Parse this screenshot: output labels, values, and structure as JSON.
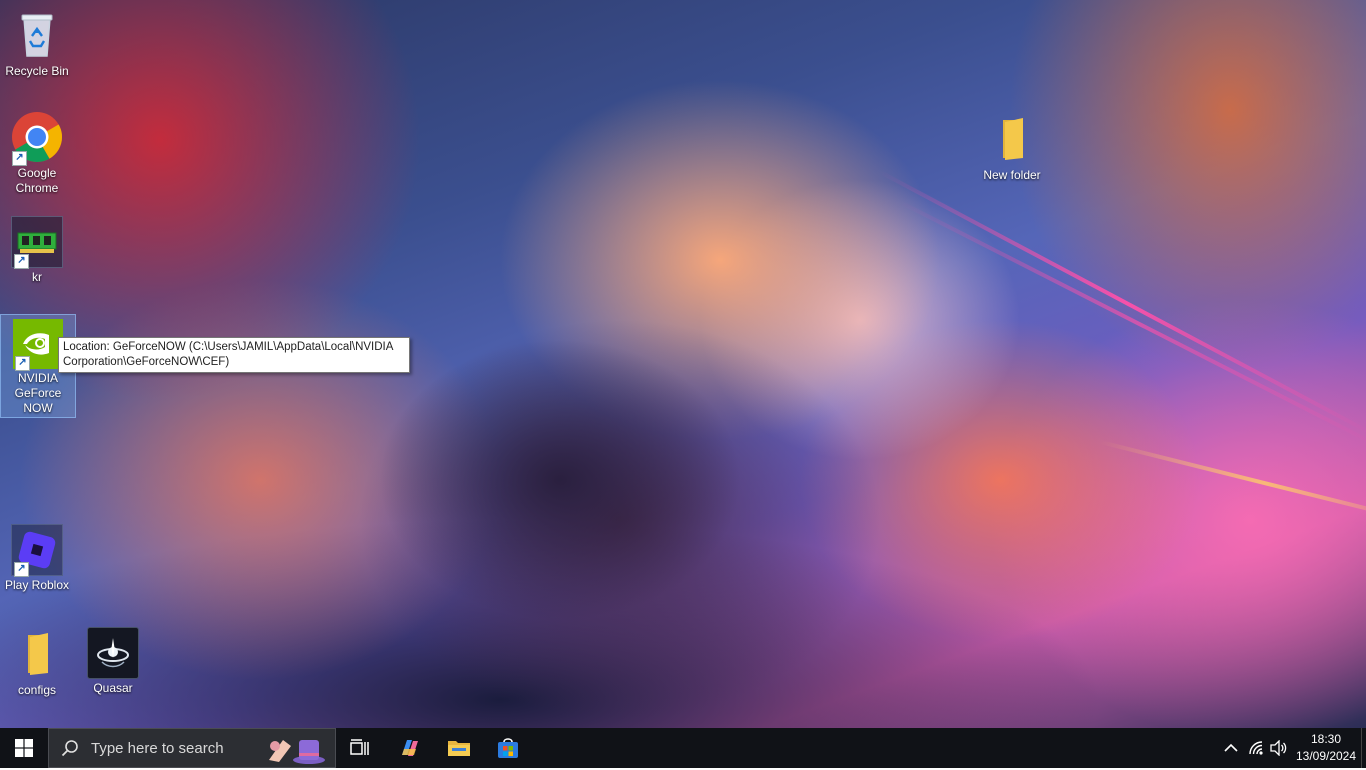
{
  "desktop": {
    "icons": [
      {
        "label": "Recycle Bin",
        "icon": "recycle-bin-icon",
        "shortcut": false
      },
      {
        "label": "Google Chrome",
        "icon": "chrome-icon",
        "shortcut": true
      },
      {
        "label": "kr",
        "icon": "memory-chip-icon",
        "shortcut": true
      },
      {
        "label": "NVIDIA GeForce NOW",
        "icon": "nvidia-icon",
        "shortcut": true,
        "selected": true
      },
      {
        "label": "Play Roblox",
        "icon": "roblox-icon",
        "shortcut": true
      },
      {
        "label": "configs",
        "icon": "folder-icon",
        "shortcut": false
      },
      {
        "label": "Quasar",
        "icon": "quasar-icon",
        "shortcut": false
      },
      {
        "label": "New folder",
        "icon": "folder-icon",
        "shortcut": false
      }
    ],
    "tooltip": "Location: GeForceNOW (C:\\Users\\JAMIL\\AppData\\Local\\NVIDIA Corporation\\GeForceNOW\\CEF)"
  },
  "taskbar": {
    "start_icon": "windows-logo-icon",
    "search_placeholder": "Type here to search",
    "pinned": [
      {
        "name": "task-view-icon"
      },
      {
        "name": "copilot-icon"
      },
      {
        "name": "file-explorer-icon"
      },
      {
        "name": "microsoft-store-icon"
      }
    ],
    "tray": {
      "time": "18:30",
      "date": "13/09/2024",
      "icons": [
        "chevron-up-icon",
        "network-icon",
        "volume-icon"
      ]
    }
  },
  "colors": {
    "taskbar_bg": "#101217",
    "search_bg": "#2c2e33",
    "folder_yellow": "#f4c84a",
    "nvidia_green": "#76b900"
  }
}
